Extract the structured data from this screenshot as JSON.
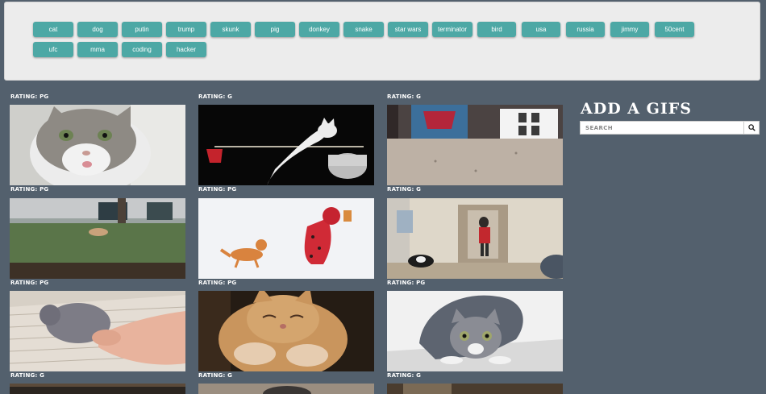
{
  "tags": [
    "cat",
    "dog",
    "putin",
    "trump",
    "skunk",
    "pig",
    "donkey",
    "snake",
    "star wars",
    "terminator",
    "bird",
    "usa",
    "russia",
    "jimmy",
    "50cent",
    "ufc",
    "mma",
    "coding",
    "hacker"
  ],
  "results": [
    {
      "rating": "Rating: pg"
    },
    {
      "rating": "Rating: g"
    },
    {
      "rating": "Rating: g"
    },
    {
      "rating": "Rating: pg"
    },
    {
      "rating": "Rating: pg"
    },
    {
      "rating": "Rating: g"
    },
    {
      "rating": "Rating: pg"
    },
    {
      "rating": "Rating: pg"
    },
    {
      "rating": "Rating: pg"
    },
    {
      "rating": "Rating: g"
    },
    {
      "rating": "Rating: g"
    },
    {
      "rating": "Rating: g"
    }
  ],
  "sidebar": {
    "title": "Add A Gifs",
    "search_placeholder": "Search",
    "search_icon": "search-icon"
  },
  "colors": {
    "background": "#53606d",
    "button": "#4da8a5",
    "topbar": "#ececec"
  }
}
